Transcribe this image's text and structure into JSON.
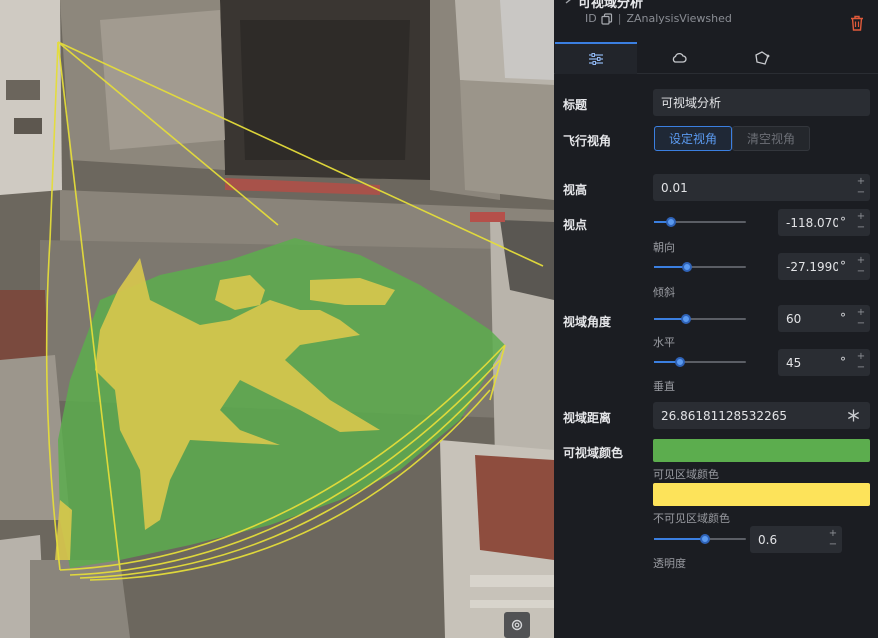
{
  "header": {
    "title": "可视域分析",
    "id_label": "ID",
    "id_value": "ZAnalysisViewshed"
  },
  "tabs": [
    {
      "name": "settings-tab",
      "icon": "sliders-icon",
      "active": true
    },
    {
      "name": "cloud-tab",
      "icon": "cloud-icon",
      "active": false
    },
    {
      "name": "shape-tab",
      "icon": "polygon-icon",
      "active": false
    }
  ],
  "fields": {
    "title": {
      "label": "标题",
      "value": "可视域分析"
    },
    "fly": {
      "label": "飞行视角",
      "set_label": "设定视角",
      "clear_label": "清空视角"
    },
    "height": {
      "label": "视高",
      "value": "0.01"
    },
    "viewpoint": {
      "label": "视点",
      "heading": {
        "value": "-118.0706",
        "unit": "°",
        "sublabel": "朝向",
        "slider_fraction": 0.19
      },
      "pitch": {
        "value": "-27.1990",
        "unit": "°",
        "sublabel": "倾斜",
        "slider_fraction": 0.36
      }
    },
    "fov": {
      "label": "视域角度",
      "horizontal": {
        "value": "60",
        "unit": "°",
        "sublabel": "水平",
        "slider_fraction": 0.35
      },
      "vertical": {
        "value": "45",
        "unit": "°",
        "sublabel": "垂直",
        "slider_fraction": 0.28
      }
    },
    "distance": {
      "label": "视域距离",
      "value": "26.86181128532265"
    },
    "color": {
      "label": "可视域颜色",
      "visible": {
        "sublabel": "可见区域颜色",
        "color": "#5cad4e"
      },
      "invisible": {
        "sublabel": "不可见区域颜色",
        "color": "#fde35a"
      },
      "opacity": {
        "value": "0.6",
        "sublabel": "透明度",
        "slider_fraction": 0.55
      }
    }
  },
  "spin_up": "+",
  "spin_down": "−",
  "viewport": {
    "settings_icon": "gear-icon"
  },
  "colors": {
    "accent": "#3b7fe0",
    "panel_bg": "#1b1d22",
    "delete": "#e05a3a"
  }
}
